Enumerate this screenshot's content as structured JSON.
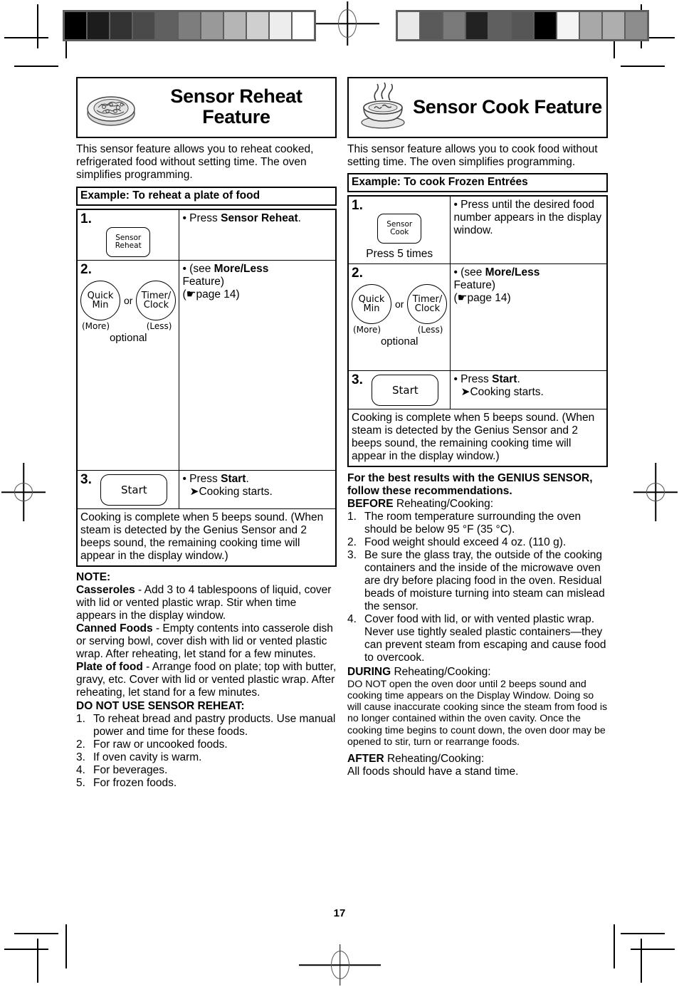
{
  "page": {
    "number": "17"
  },
  "marks": {
    "left_strip": [
      "#000000",
      "#1c1c1c",
      "#333333",
      "#4a4a4a",
      "#606060",
      "#7d7d7d",
      "#999999",
      "#b5b5b5",
      "#cfcfcf",
      "#ededed",
      "#ffffff"
    ],
    "right_strip": [
      "#e9e9e9",
      "#5a5a5a",
      "#7a7a7a",
      "#222222",
      "#5f5f5f",
      "#565656",
      "#000000",
      "#f4f4f4",
      "#a8a8a8",
      "#aeaeae",
      "#8d8d8d"
    ]
  },
  "left": {
    "icon": "plate-of-food-icon",
    "title": "Sensor Reheat Feature",
    "intro": "This sensor feature allows you to reheat cooked, refrigerated food without setting time. The oven simplifies programming.",
    "example_label": "Example: To reheat a plate of food",
    "steps": [
      {
        "number": "1.",
        "pad": {
          "line1": "Sensor",
          "line2": "Reheat"
        },
        "instruction_prefix": "• Press ",
        "instruction_bold": "Sensor Reheat",
        "instruction_suffix": "."
      },
      {
        "number": "2.",
        "circle_left": {
          "line1": "Quick",
          "line2": "Min"
        },
        "or": "or",
        "circle_right": {
          "line1": "Timer/",
          "line2": "Clock"
        },
        "sub_left": "(More)",
        "sub_right": "(Less)",
        "optional": "optional",
        "instruction_prefix": "• (see ",
        "instruction_bold": "More/Less",
        "instruction_line2": "Feature)",
        "instruction_line3": "(☛page 14)"
      },
      {
        "number": "3.",
        "pad": {
          "line1": "Start"
        },
        "instruction_prefix": "• Press ",
        "instruction_bold": "Start",
        "instruction_suffix": ".",
        "instruction_line2": "➤Cooking starts."
      }
    ],
    "footer": "Cooking is complete when 5 beeps sound. (When steam is detected by the Genius Sensor and 2 beeps sound, the remaining cooking time will appear in the display window.)",
    "note_label": "NOTE:",
    "notes": [
      {
        "term": "Casseroles",
        "text": " - Add 3 to 4 tablespoons of liquid, cover with lid or vented plastic wrap. Stir when time appears in the display window."
      },
      {
        "term": "Canned Foods",
        "text": " - Empty contents into casserole dish or serving bowl, cover dish with lid or vented plastic wrap. After reheating, let stand for a few minutes."
      },
      {
        "term": "Plate of food",
        "text": " - Arrange food on plate; top with butter, gravy, etc. Cover with lid or vented plastic wrap. After reheating, let stand for a few minutes."
      }
    ],
    "donot_label": "DO NOT USE SENSOR REHEAT:",
    "donot_items": [
      {
        "n": "1.",
        "text": "To reheat bread and pastry products. Use manual power and time for these foods."
      },
      {
        "n": "2.",
        "text": "For raw or uncooked foods."
      },
      {
        "n": "3.",
        "text": "If oven cavity is warm."
      },
      {
        "n": "4.",
        "text": "For beverages."
      },
      {
        "n": "5.",
        "text": "For frozen foods."
      }
    ]
  },
  "right": {
    "icon": "steaming-bowl-icon",
    "title": "Sensor Cook Feature",
    "intro": "This sensor feature allows you to cook food without setting time. The oven simplifies programming.",
    "example_label": "Example: To cook Frozen Entrées",
    "steps": [
      {
        "number": "1.",
        "pad": {
          "line1": "Sensor",
          "line2": "Cook"
        },
        "press_times": "Press 5 times",
        "instruction": "• Press until the desired food number appears in the display window."
      },
      {
        "number": "2.",
        "circle_left": {
          "line1": "Quick",
          "line2": "Min"
        },
        "or": "or",
        "circle_right": {
          "line1": "Timer/",
          "line2": "Clock"
        },
        "sub_left": "(More)",
        "sub_right": "(Less)",
        "optional": "optional",
        "instruction_prefix": "• (see ",
        "instruction_bold": "More/Less",
        "instruction_line2": "Feature)",
        "instruction_line3": "(☛page 14)"
      },
      {
        "number": "3.",
        "pad": {
          "line1": "Start"
        },
        "instruction_prefix": "• Press ",
        "instruction_bold": "Start",
        "instruction_suffix": ".",
        "instruction_line2": "➤Cooking starts."
      }
    ],
    "footer": "Cooking is complete when 5 beeps sound. (When steam is detected by the Genius Sensor and 2 beeps sound, the remaining cooking time will appear in the display window.)",
    "best_results_heading": "For the best results with the GENIUS SENSOR, follow these recommendations.",
    "before_label": "BEFORE",
    "before_suffix": " Reheating/Cooking:",
    "before_items": [
      {
        "n": "1.",
        "text": "The room temperature surrounding the oven should be below 95 °F (35 °C)."
      },
      {
        "n": "2.",
        "text": "Food weight should exceed 4 oz. (110 g)."
      },
      {
        "n": "3.",
        "text": "Be sure the glass tray, the outside of the cooking containers and the inside of the microwave oven are dry before placing food in the oven. Residual beads of moisture turning into steam can mislead the sensor."
      },
      {
        "n": "4.",
        "text": "Cover food with lid, or with vented plastic wrap. Never use tightly sealed plastic containers—they can prevent steam from escaping and cause food to overcook."
      }
    ],
    "during_label": "DURING",
    "during_suffix": " Reheating/Cooking:",
    "during_text": "DO NOT open the oven door until 2 beeps sound and cooking time appears on the Display Window. Doing so will cause inaccurate cooking since the steam from food is no longer contained within the oven cavity. Once the cooking time begins to count down, the oven door may be opened to stir, turn or rearrange foods.",
    "after_label": "AFTER",
    "after_suffix": " Reheating/Cooking:",
    "after_text": "All foods should have a stand time."
  }
}
